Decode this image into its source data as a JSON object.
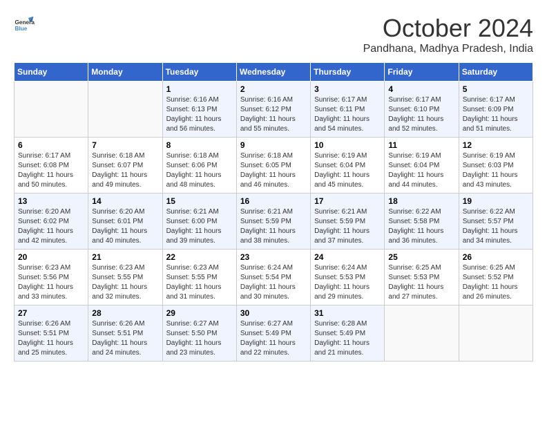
{
  "header": {
    "logo_line1": "General",
    "logo_line2": "Blue",
    "month": "October 2024",
    "location": "Pandhana, Madhya Pradesh, India"
  },
  "columns": [
    "Sunday",
    "Monday",
    "Tuesday",
    "Wednesday",
    "Thursday",
    "Friday",
    "Saturday"
  ],
  "weeks": [
    [
      {
        "day": "",
        "sunrise": "",
        "sunset": "",
        "daylight": ""
      },
      {
        "day": "",
        "sunrise": "",
        "sunset": "",
        "daylight": ""
      },
      {
        "day": "1",
        "sunrise": "Sunrise: 6:16 AM",
        "sunset": "Sunset: 6:13 PM",
        "daylight": "Daylight: 11 hours and 56 minutes."
      },
      {
        "day": "2",
        "sunrise": "Sunrise: 6:16 AM",
        "sunset": "Sunset: 6:12 PM",
        "daylight": "Daylight: 11 hours and 55 minutes."
      },
      {
        "day": "3",
        "sunrise": "Sunrise: 6:17 AM",
        "sunset": "Sunset: 6:11 PM",
        "daylight": "Daylight: 11 hours and 54 minutes."
      },
      {
        "day": "4",
        "sunrise": "Sunrise: 6:17 AM",
        "sunset": "Sunset: 6:10 PM",
        "daylight": "Daylight: 11 hours and 52 minutes."
      },
      {
        "day": "5",
        "sunrise": "Sunrise: 6:17 AM",
        "sunset": "Sunset: 6:09 PM",
        "daylight": "Daylight: 11 hours and 51 minutes."
      }
    ],
    [
      {
        "day": "6",
        "sunrise": "Sunrise: 6:17 AM",
        "sunset": "Sunset: 6:08 PM",
        "daylight": "Daylight: 11 hours and 50 minutes."
      },
      {
        "day": "7",
        "sunrise": "Sunrise: 6:18 AM",
        "sunset": "Sunset: 6:07 PM",
        "daylight": "Daylight: 11 hours and 49 minutes."
      },
      {
        "day": "8",
        "sunrise": "Sunrise: 6:18 AM",
        "sunset": "Sunset: 6:06 PM",
        "daylight": "Daylight: 11 hours and 48 minutes."
      },
      {
        "day": "9",
        "sunrise": "Sunrise: 6:18 AM",
        "sunset": "Sunset: 6:05 PM",
        "daylight": "Daylight: 11 hours and 46 minutes."
      },
      {
        "day": "10",
        "sunrise": "Sunrise: 6:19 AM",
        "sunset": "Sunset: 6:04 PM",
        "daylight": "Daylight: 11 hours and 45 minutes."
      },
      {
        "day": "11",
        "sunrise": "Sunrise: 6:19 AM",
        "sunset": "Sunset: 6:04 PM",
        "daylight": "Daylight: 11 hours and 44 minutes."
      },
      {
        "day": "12",
        "sunrise": "Sunrise: 6:19 AM",
        "sunset": "Sunset: 6:03 PM",
        "daylight": "Daylight: 11 hours and 43 minutes."
      }
    ],
    [
      {
        "day": "13",
        "sunrise": "Sunrise: 6:20 AM",
        "sunset": "Sunset: 6:02 PM",
        "daylight": "Daylight: 11 hours and 42 minutes."
      },
      {
        "day": "14",
        "sunrise": "Sunrise: 6:20 AM",
        "sunset": "Sunset: 6:01 PM",
        "daylight": "Daylight: 11 hours and 40 minutes."
      },
      {
        "day": "15",
        "sunrise": "Sunrise: 6:21 AM",
        "sunset": "Sunset: 6:00 PM",
        "daylight": "Daylight: 11 hours and 39 minutes."
      },
      {
        "day": "16",
        "sunrise": "Sunrise: 6:21 AM",
        "sunset": "Sunset: 5:59 PM",
        "daylight": "Daylight: 11 hours and 38 minutes."
      },
      {
        "day": "17",
        "sunrise": "Sunrise: 6:21 AM",
        "sunset": "Sunset: 5:59 PM",
        "daylight": "Daylight: 11 hours and 37 minutes."
      },
      {
        "day": "18",
        "sunrise": "Sunrise: 6:22 AM",
        "sunset": "Sunset: 5:58 PM",
        "daylight": "Daylight: 11 hours and 36 minutes."
      },
      {
        "day": "19",
        "sunrise": "Sunrise: 6:22 AM",
        "sunset": "Sunset: 5:57 PM",
        "daylight": "Daylight: 11 hours and 34 minutes."
      }
    ],
    [
      {
        "day": "20",
        "sunrise": "Sunrise: 6:23 AM",
        "sunset": "Sunset: 5:56 PM",
        "daylight": "Daylight: 11 hours and 33 minutes."
      },
      {
        "day": "21",
        "sunrise": "Sunrise: 6:23 AM",
        "sunset": "Sunset: 5:55 PM",
        "daylight": "Daylight: 11 hours and 32 minutes."
      },
      {
        "day": "22",
        "sunrise": "Sunrise: 6:23 AM",
        "sunset": "Sunset: 5:55 PM",
        "daylight": "Daylight: 11 hours and 31 minutes."
      },
      {
        "day": "23",
        "sunrise": "Sunrise: 6:24 AM",
        "sunset": "Sunset: 5:54 PM",
        "daylight": "Daylight: 11 hours and 30 minutes."
      },
      {
        "day": "24",
        "sunrise": "Sunrise: 6:24 AM",
        "sunset": "Sunset: 5:53 PM",
        "daylight": "Daylight: 11 hours and 29 minutes."
      },
      {
        "day": "25",
        "sunrise": "Sunrise: 6:25 AM",
        "sunset": "Sunset: 5:53 PM",
        "daylight": "Daylight: 11 hours and 27 minutes."
      },
      {
        "day": "26",
        "sunrise": "Sunrise: 6:25 AM",
        "sunset": "Sunset: 5:52 PM",
        "daylight": "Daylight: 11 hours and 26 minutes."
      }
    ],
    [
      {
        "day": "27",
        "sunrise": "Sunrise: 6:26 AM",
        "sunset": "Sunset: 5:51 PM",
        "daylight": "Daylight: 11 hours and 25 minutes."
      },
      {
        "day": "28",
        "sunrise": "Sunrise: 6:26 AM",
        "sunset": "Sunset: 5:51 PM",
        "daylight": "Daylight: 11 hours and 24 minutes."
      },
      {
        "day": "29",
        "sunrise": "Sunrise: 6:27 AM",
        "sunset": "Sunset: 5:50 PM",
        "daylight": "Daylight: 11 hours and 23 minutes."
      },
      {
        "day": "30",
        "sunrise": "Sunrise: 6:27 AM",
        "sunset": "Sunset: 5:49 PM",
        "daylight": "Daylight: 11 hours and 22 minutes."
      },
      {
        "day": "31",
        "sunrise": "Sunrise: 6:28 AM",
        "sunset": "Sunset: 5:49 PM",
        "daylight": "Daylight: 11 hours and 21 minutes."
      },
      {
        "day": "",
        "sunrise": "",
        "sunset": "",
        "daylight": ""
      },
      {
        "day": "",
        "sunrise": "",
        "sunset": "",
        "daylight": ""
      }
    ]
  ]
}
